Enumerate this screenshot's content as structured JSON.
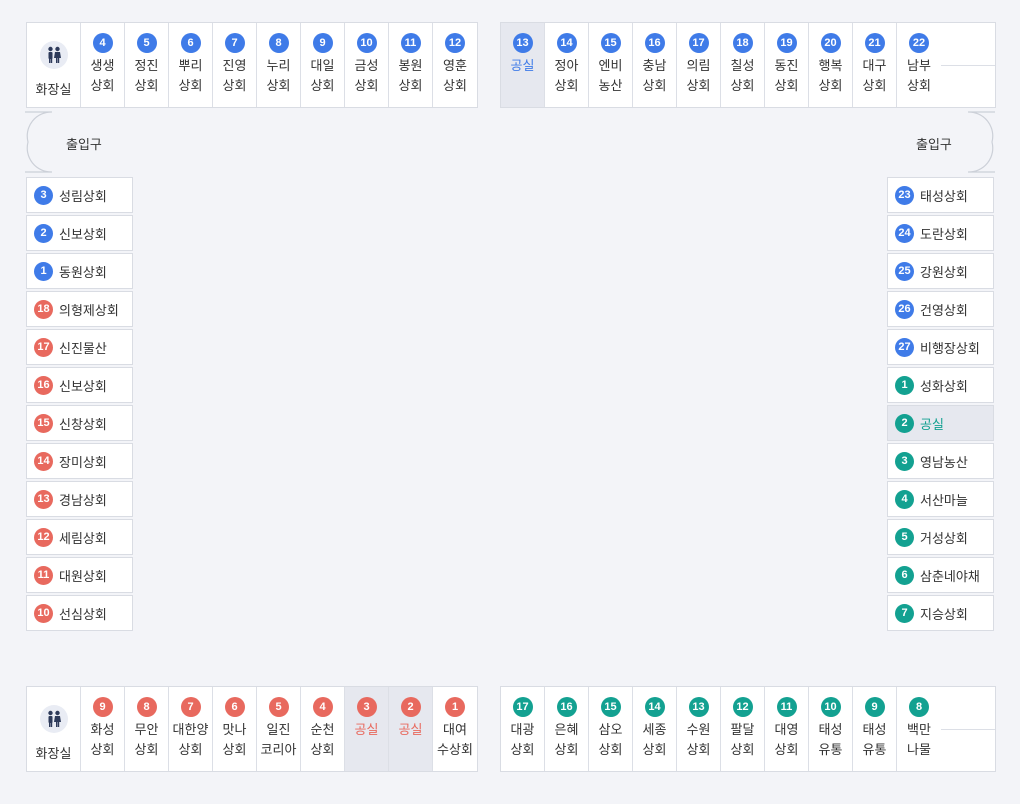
{
  "restroom_label": "화장실",
  "entrance_label": "출입구",
  "colors": {
    "blue": "#3f7be8",
    "red": "#e8695e",
    "green": "#13a191",
    "vacant_bg": "#e6e8ef"
  },
  "top_left": [
    {
      "num": "4",
      "name": "생생\n상회"
    },
    {
      "num": "5",
      "name": "정진\n상회"
    },
    {
      "num": "6",
      "name": "뿌리\n상회"
    },
    {
      "num": "7",
      "name": "진영\n상회"
    },
    {
      "num": "8",
      "name": "누리\n상회"
    },
    {
      "num": "9",
      "name": "대일\n상회"
    },
    {
      "num": "10",
      "name": "금성\n상회"
    },
    {
      "num": "11",
      "name": "봉원\n상회"
    },
    {
      "num": "12",
      "name": "영훈\n상회"
    }
  ],
  "top_right": [
    {
      "num": "13",
      "name": "공실",
      "vacant": true
    },
    {
      "num": "14",
      "name": "정아\n상회"
    },
    {
      "num": "15",
      "name": "엔비\n농산"
    },
    {
      "num": "16",
      "name": "충남\n상회"
    },
    {
      "num": "17",
      "name": "의림\n상회"
    },
    {
      "num": "18",
      "name": "칠성\n상회"
    },
    {
      "num": "19",
      "name": "동진\n상회"
    },
    {
      "num": "20",
      "name": "행복\n상회"
    },
    {
      "num": "21",
      "name": "대구\n상회"
    },
    {
      "num": "22",
      "name": "남부\n상회"
    }
  ],
  "left_col": [
    {
      "num": "3",
      "name": "성림상회",
      "color": "blue"
    },
    {
      "num": "2",
      "name": "신보상회",
      "color": "blue"
    },
    {
      "num": "1",
      "name": "동원상회",
      "color": "blue"
    },
    {
      "num": "18",
      "name": "의형제상회",
      "color": "red"
    },
    {
      "num": "17",
      "name": "신진물산",
      "color": "red"
    },
    {
      "num": "16",
      "name": "신보상회",
      "color": "red"
    },
    {
      "num": "15",
      "name": "신창상회",
      "color": "red"
    },
    {
      "num": "14",
      "name": "장미상회",
      "color": "red"
    },
    {
      "num": "13",
      "name": "경남상회",
      "color": "red"
    },
    {
      "num": "12",
      "name": "세림상회",
      "color": "red"
    },
    {
      "num": "11",
      "name": "대원상회",
      "color": "red"
    },
    {
      "num": "10",
      "name": "선심상회",
      "color": "red"
    }
  ],
  "right_col": [
    {
      "num": "23",
      "name": "태성상회",
      "color": "blue"
    },
    {
      "num": "24",
      "name": "도란상회",
      "color": "blue"
    },
    {
      "num": "25",
      "name": "강원상회",
      "color": "blue"
    },
    {
      "num": "26",
      "name": "건영상회",
      "color": "blue"
    },
    {
      "num": "27",
      "name": "비행장상회",
      "color": "blue"
    },
    {
      "num": "1",
      "name": "성화상회",
      "color": "green"
    },
    {
      "num": "2",
      "name": "공실",
      "color": "green",
      "vacant": true
    },
    {
      "num": "3",
      "name": "영남농산",
      "color": "green"
    },
    {
      "num": "4",
      "name": "서산마늘",
      "color": "green"
    },
    {
      "num": "5",
      "name": "거성상회",
      "color": "green"
    },
    {
      "num": "6",
      "name": "삼춘네야채",
      "color": "green"
    },
    {
      "num": "7",
      "name": "지승상회",
      "color": "green"
    }
  ],
  "bottom_left": [
    {
      "num": "9",
      "name": "화성\n상회"
    },
    {
      "num": "8",
      "name": "무안\n상회"
    },
    {
      "num": "7",
      "name": "대한양\n상회"
    },
    {
      "num": "6",
      "name": "맛나\n상회"
    },
    {
      "num": "5",
      "name": "일진\n코리아"
    },
    {
      "num": "4",
      "name": "순천\n상회"
    },
    {
      "num": "3",
      "name": "공실",
      "vacant": true
    },
    {
      "num": "2",
      "name": "공실",
      "vacant": true
    },
    {
      "num": "1",
      "name": "대여\n수상회"
    }
  ],
  "bottom_right": [
    {
      "num": "17",
      "name": "대광\n상회"
    },
    {
      "num": "16",
      "name": "은혜\n상회"
    },
    {
      "num": "15",
      "name": "삼오\n상회"
    },
    {
      "num": "14",
      "name": "세종\n상회"
    },
    {
      "num": "13",
      "name": "수원\n상회"
    },
    {
      "num": "12",
      "name": "팔달\n상회"
    },
    {
      "num": "11",
      "name": "대영\n상회"
    },
    {
      "num": "10",
      "name": "태성\n유통"
    },
    {
      "num": "9",
      "name": "태성\n유통"
    },
    {
      "num": "8",
      "name": "백만\n나물"
    }
  ]
}
